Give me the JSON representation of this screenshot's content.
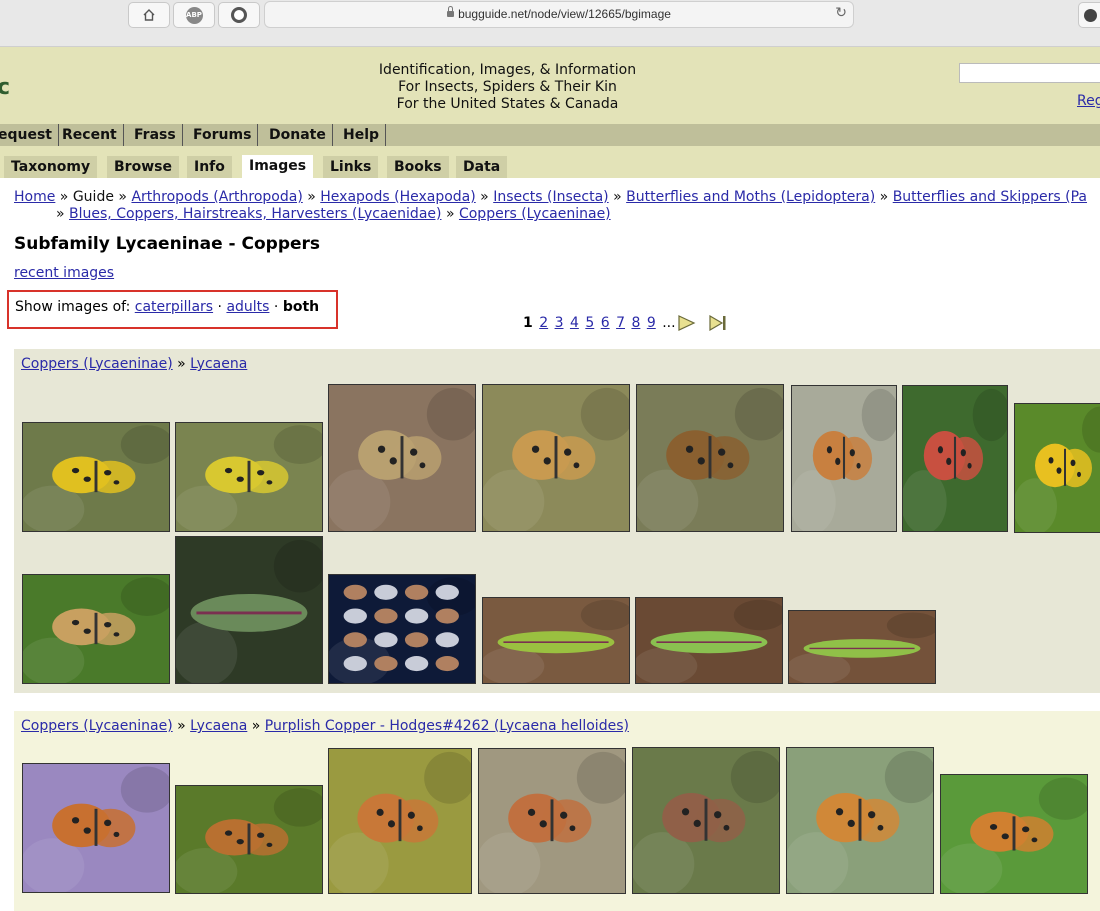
{
  "browser": {
    "url": "bugguide.net/node/view/12665/bgimage",
    "home_icon": "home-icon",
    "abp_label": "ABP",
    "record_icon": "circle-icon"
  },
  "header": {
    "logo_fragment": "c",
    "tagline": [
      "Identification, Images, & Information",
      "For Insects, Spiders & Their Kin",
      "For the United States & Canada"
    ],
    "search_placeholder": "",
    "register_link": "Reg"
  },
  "topnav": [
    "equest",
    "Recent",
    "Frass",
    "Forums",
    "Donate",
    "Help"
  ],
  "tabs": [
    "Taxonomy",
    "Browse",
    "Info",
    "Images",
    "Links",
    "Books",
    "Data"
  ],
  "active_tab": "Images",
  "breadcrumb": {
    "home": "Home",
    "guide": "Guide",
    "items": [
      "Arthropods (Arthropoda)",
      "Hexapods (Hexapoda)",
      "Insects (Insecta)",
      "Butterflies and Moths (Lepidoptera)",
      "Butterflies and Skippers (Pa"
    ],
    "line2": [
      "Blues, Coppers, Hairstreaks, Harvesters (Lycaenidae)",
      "Coppers (Lycaeninae)"
    ]
  },
  "page_title": "Subfamily Lycaeninae - Coppers",
  "recent_images": "recent images",
  "show_images": {
    "prefix": "Show images of:",
    "caterpillars": "caterpillars",
    "adults": "adults",
    "both": "both",
    "dot": "·"
  },
  "pager": {
    "current": "1",
    "pages": [
      "2",
      "3",
      "4",
      "5",
      "6",
      "7",
      "8",
      "9"
    ],
    "ellipsis": "...",
    "next_icon": "next-arrow-icon",
    "last_icon": "last-arrow-icon"
  },
  "sections": [
    {
      "crumb": [
        "Coppers (Lycaeninae)",
        "Lycaena"
      ],
      "thumbnails": [
        {
          "subject": "butterfly-on-flower",
          "bg": "#6e7a4a",
          "fg": "#e0c020"
        },
        {
          "subject": "butterfly-on-grass",
          "bg": "#7a8450",
          "fg": "#d8c830"
        },
        {
          "subject": "butterfly-closeup",
          "bg": "#8a7460",
          "fg": "#b8a070"
        },
        {
          "subject": "butterfly-on-white-flowers",
          "bg": "#8c8a5a",
          "fg": "#c89a50"
        },
        {
          "subject": "butterfly-on-white-flowers",
          "bg": "#7a7c58",
          "fg": "#8a6030"
        },
        {
          "subject": "butterfly-on-stem",
          "bg": "#a8aa9a",
          "fg": "#c88040"
        },
        {
          "subject": "butterfly-red",
          "bg": "#3e6a2e",
          "fg": "#c85040"
        },
        {
          "subject": "butterfly-on-yellow",
          "bg": "#5a8a2a",
          "fg": "#e8c020"
        },
        {
          "subject": "butterfly-on-yellow-flower",
          "bg": "#4a7a2a",
          "fg": "#c8a060"
        },
        {
          "subject": "caterpillar-fuzzy",
          "bg": "#2e3a26",
          "fg": "#6a8a5a"
        },
        {
          "subject": "pinned-specimens",
          "bg": "#0e1a38",
          "fg": "#b08060"
        },
        {
          "subject": "caterpillar-green",
          "bg": "#7a5a40",
          "fg": "#9ac040"
        },
        {
          "subject": "caterpillar-green",
          "bg": "#6a4a34",
          "fg": "#8ac050"
        },
        {
          "subject": "caterpillar-green",
          "bg": "#74523a",
          "fg": "#90c048"
        }
      ]
    },
    {
      "crumb": [
        "Coppers (Lycaeninae)",
        "Lycaena",
        "Purplish Copper - Hodges#4262 (Lycaena helloides)"
      ],
      "thumbnails": [
        {
          "subject": "butterfly-on-purple-aster",
          "bg": "#9a88c0",
          "fg": "#c87030"
        },
        {
          "subject": "butterfly-on-yellow-flowers",
          "bg": "#5a7a2a",
          "fg": "#b87030"
        },
        {
          "subject": "butterfly-on-goldenrod",
          "bg": "#9a9a40",
          "fg": "#c87838"
        },
        {
          "subject": "butterfly-on-white-aster",
          "bg": "#a09880",
          "fg": "#c07040"
        },
        {
          "subject": "butterfly-on-leaf",
          "bg": "#6a7a4a",
          "fg": "#906048"
        },
        {
          "subject": "butterfly-open-wings",
          "bg": "#8aa07a",
          "fg": "#d08838"
        },
        {
          "subject": "butterfly-open-wings",
          "bg": "#5a9a3a",
          "fg": "#d08030"
        }
      ]
    }
  ],
  "colors": {
    "header_bg": "#e3e3b8",
    "nav_bg": "#bfbf9a",
    "tab_bg": "#cfcfa6",
    "link": "#2a2aa8",
    "highlight_box": "#d8322a"
  }
}
